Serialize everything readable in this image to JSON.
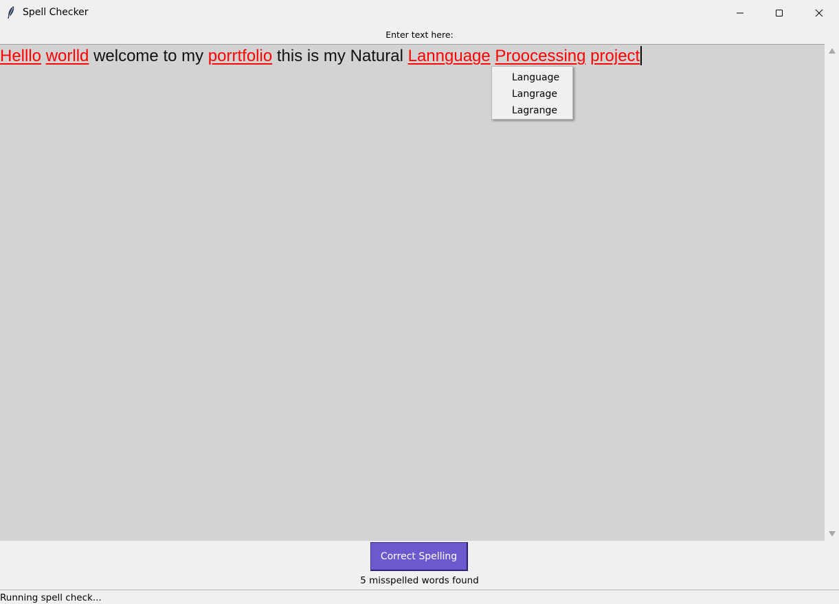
{
  "window": {
    "title": "Spell Checker",
    "icon": "feather-icon",
    "controls": [
      "minimize-icon",
      "maximize-icon",
      "close-icon"
    ]
  },
  "label": "Enter text here:",
  "text_area": {
    "background": "#d3d3d3",
    "misspelled_color": "#ff0000",
    "words": [
      {
        "text": "Helllo",
        "misspelled": true
      },
      {
        "text": "worlld",
        "misspelled": true
      },
      {
        "text": "welcome",
        "misspelled": false
      },
      {
        "text": "to",
        "misspelled": false
      },
      {
        "text": "my",
        "misspelled": false
      },
      {
        "text": "porrtfolio",
        "misspelled": true
      },
      {
        "text": "this",
        "misspelled": false
      },
      {
        "text": "is",
        "misspelled": false
      },
      {
        "text": "my",
        "misspelled": false
      },
      {
        "text": "Natural",
        "misspelled": false
      },
      {
        "text": "Lannguage",
        "misspelled": true
      },
      {
        "text": "Proocessing",
        "misspelled": true
      },
      {
        "text": "project",
        "misspelled": true
      }
    ]
  },
  "suggestions": [
    "Language",
    "Langrage",
    "Lagrange"
  ],
  "button": {
    "label": "Correct Spelling",
    "color": "#6a5acd"
  },
  "result": "5 misspelled words found",
  "status": "Running spell check..."
}
